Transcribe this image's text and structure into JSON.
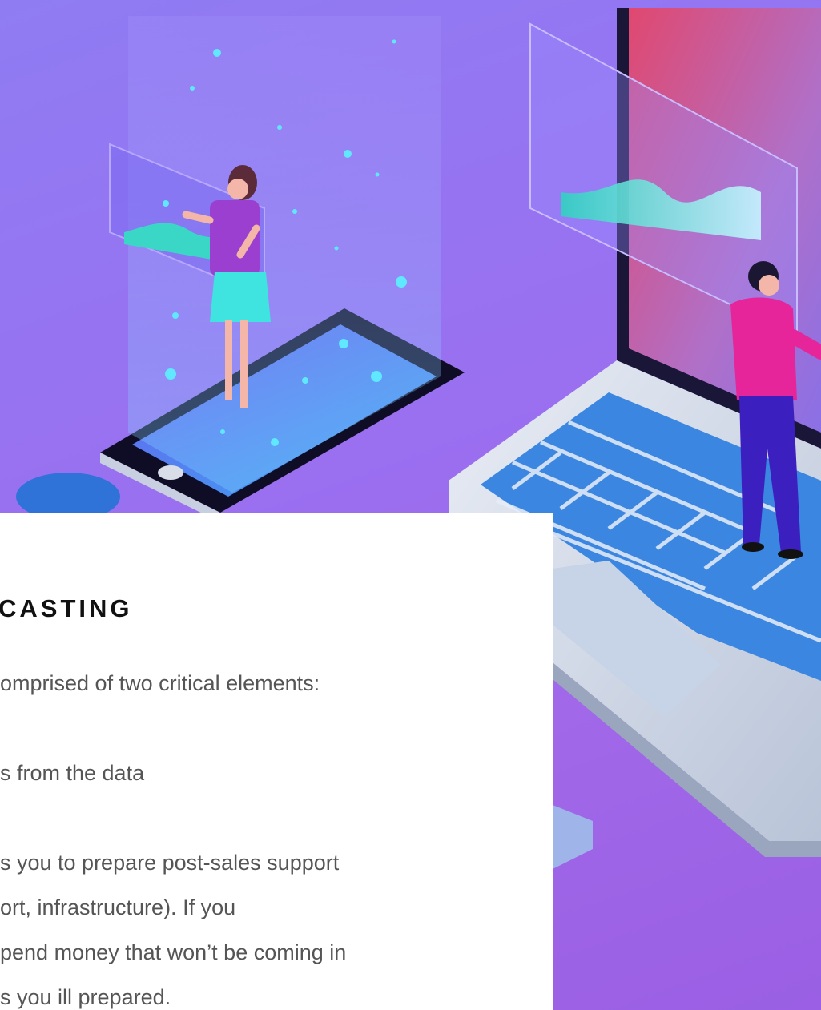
{
  "article": {
    "heading": "CASTING",
    "lines": [
      "omprised of two critical elements:",
      "s from the data",
      "s you to prepare post-sales support",
      "ort, infrastructure). If you",
      "pend money that won’t be coming in",
      "s you ill prepared."
    ]
  },
  "colors": {
    "background_purple": "#9a6ff0",
    "laptop_screen": "#d74c7a",
    "keyboard_key": "#3b86e0",
    "accent_cyan": "#4fe3e0"
  }
}
